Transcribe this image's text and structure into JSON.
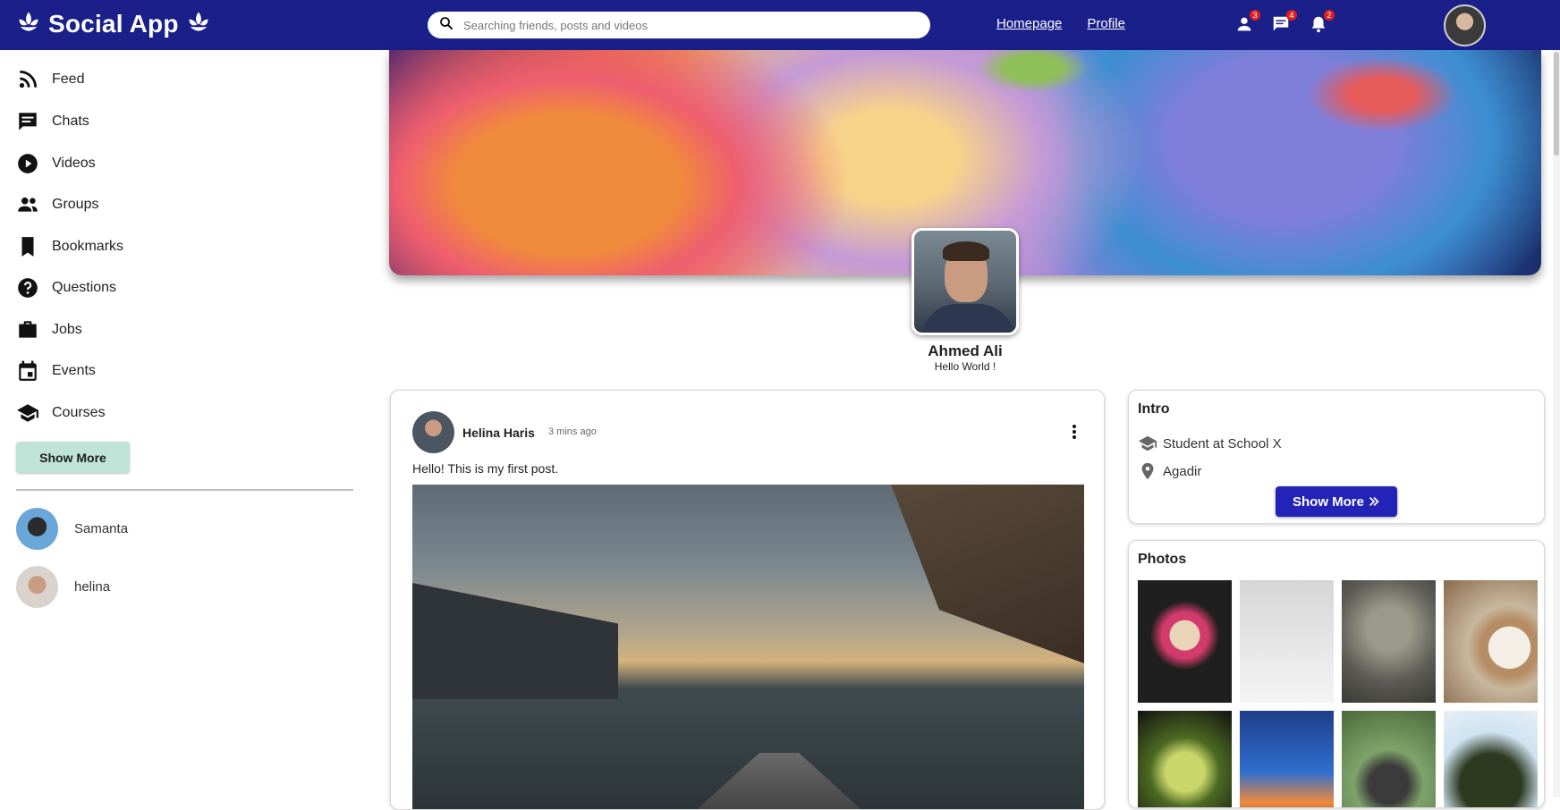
{
  "app": {
    "title": "Social App"
  },
  "search": {
    "placeholder": "Searching friends, posts and videos"
  },
  "nav": {
    "homepage": "Homepage",
    "profile": "Profile"
  },
  "notifications": {
    "friend_requests": "3",
    "messages": "4",
    "alerts": "2"
  },
  "sidebar": {
    "items": [
      {
        "label": "Feed",
        "icon": "rss-icon"
      },
      {
        "label": "Chats",
        "icon": "chat-icon"
      },
      {
        "label": "Videos",
        "icon": "play-circle-icon"
      },
      {
        "label": "Groups",
        "icon": "group-icon"
      },
      {
        "label": "Bookmarks",
        "icon": "bookmark-icon"
      },
      {
        "label": "Questions",
        "icon": "help-circle-icon"
      },
      {
        "label": "Jobs",
        "icon": "briefcase-icon"
      },
      {
        "label": "Events",
        "icon": "calendar-icon"
      },
      {
        "label": "Courses",
        "icon": "school-icon"
      }
    ],
    "show_more": "Show More",
    "friends": [
      {
        "name": "Samanta"
      },
      {
        "name": "helina"
      }
    ]
  },
  "profile": {
    "name": "Ahmed Ali",
    "bio": "Hello World !"
  },
  "post": {
    "author": "Helina Haris",
    "time": "3 mins ago",
    "text": "Hello! This is my first post."
  },
  "intro": {
    "title": "Intro",
    "school": "Student at School X",
    "location": "Agadir",
    "show_more": "Show More"
  },
  "photos": {
    "title": "Photos"
  },
  "colors": {
    "topbar": "#1a1f8a",
    "accent_button": "#2323b8",
    "show_more_bg": "#bfe3d6",
    "badge": "#e01e1e"
  }
}
